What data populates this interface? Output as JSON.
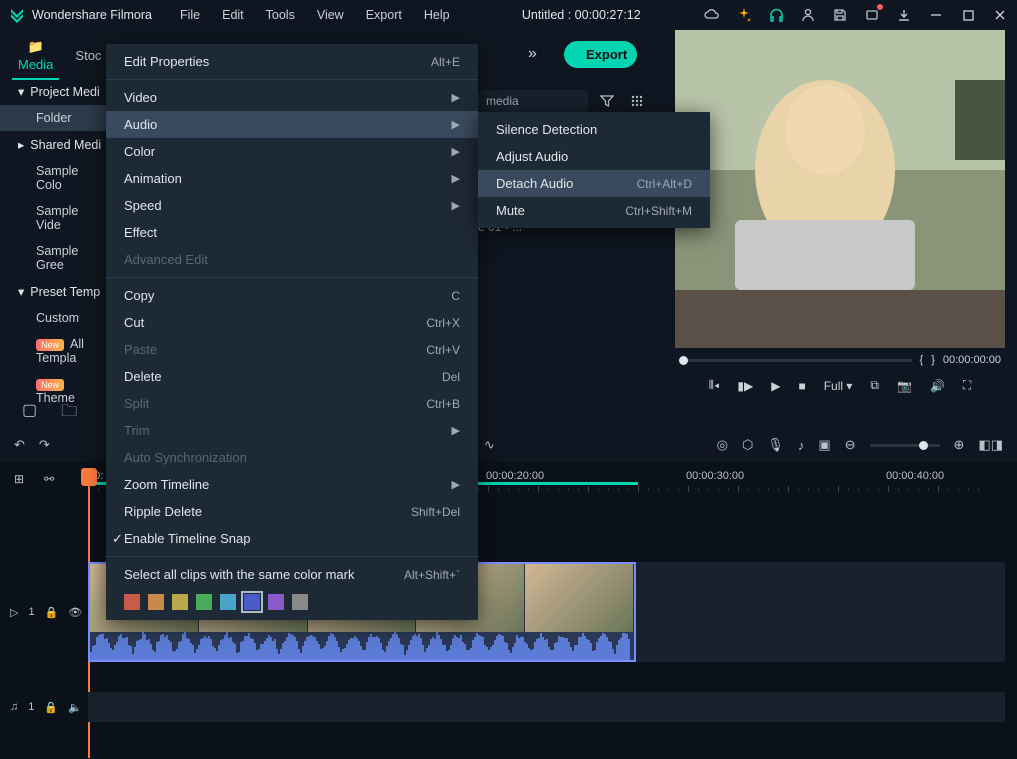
{
  "app": {
    "name": "Wondershare Filmora",
    "doc_title": "Untitled : 00:00:27:12"
  },
  "menubar": [
    "File",
    "Edit",
    "Tools",
    "View",
    "Export",
    "Help"
  ],
  "topbar": {
    "tabs": [
      "Media",
      "Stoc"
    ],
    "export_label": "Export",
    "search_placeholder": "media"
  },
  "sidebar": {
    "groups": [
      {
        "label": "Project Medi",
        "expanded": true,
        "children": [
          {
            "label": "Folder",
            "selected": true
          }
        ]
      },
      {
        "label": "Shared Medi",
        "expanded": false,
        "children": [
          {
            "label": "Sample Colo"
          },
          {
            "label": "Sample Vide"
          },
          {
            "label": "Sample Gree"
          }
        ]
      },
      {
        "label": "Preset Temp",
        "expanded": true,
        "children": [
          {
            "label": "Custom"
          },
          {
            "label": "All Templa",
            "badge": "New"
          },
          {
            "label": "Theme",
            "badge": "New"
          }
        ]
      }
    ]
  },
  "media_area": {
    "visible_item": "e 01 - ..."
  },
  "preview": {
    "braces_left": "{",
    "braces_right": "}",
    "timecode": "00:00:00:00",
    "quality_label": "Full"
  },
  "timeline": {
    "ruler": [
      "00:",
      "00:00:20:00",
      "00:00:30:00",
      "00:00:40:00"
    ],
    "tracks": {
      "video": "1",
      "audio": "1"
    },
    "audio_icon": "♫"
  },
  "context_menu": {
    "items": [
      {
        "label": "Edit Properties",
        "shortcut": "Alt+E"
      },
      {
        "sep": true
      },
      {
        "label": "Video",
        "submenu": true
      },
      {
        "label": "Audio",
        "submenu": true,
        "hover": true
      },
      {
        "label": "Color",
        "submenu": true
      },
      {
        "label": "Animation",
        "submenu": true
      },
      {
        "label": "Speed",
        "submenu": true
      },
      {
        "label": "Effect"
      },
      {
        "label": "Advanced Edit",
        "disabled": true
      },
      {
        "sep": true
      },
      {
        "label": "Copy",
        "shortcut": "C"
      },
      {
        "label": "Cut",
        "shortcut": "Ctrl+X"
      },
      {
        "label": "Paste",
        "shortcut": "Ctrl+V",
        "disabled": true
      },
      {
        "label": "Delete",
        "shortcut": "Del"
      },
      {
        "label": "Split",
        "shortcut": "Ctrl+B",
        "disabled": true
      },
      {
        "label": "Trim",
        "submenu": true,
        "disabled": true
      },
      {
        "label": "Auto Synchronization",
        "disabled": true
      },
      {
        "label": "Zoom Timeline",
        "submenu": true
      },
      {
        "label": "Ripple Delete",
        "shortcut": "Shift+Del"
      },
      {
        "label": "Enable Timeline Snap",
        "checked": true
      },
      {
        "sep": true
      },
      {
        "label": "Select all clips with the same color mark",
        "shortcut": "Alt+Shift+`"
      }
    ],
    "colors": [
      "#c85b4a",
      "#c88a4a",
      "#b8a84a",
      "#4aab5b",
      "#4aa3c8",
      "#4a5bc8",
      "#8a5bc8",
      "#8a8a8a"
    ],
    "selected_color_index": 5
  },
  "submenu": {
    "items": [
      {
        "label": "Silence Detection"
      },
      {
        "label": "Adjust Audio"
      },
      {
        "label": "Detach Audio",
        "shortcut": "Ctrl+Alt+D",
        "hover": true
      },
      {
        "label": "Mute",
        "shortcut": "Ctrl+Shift+M"
      }
    ]
  }
}
